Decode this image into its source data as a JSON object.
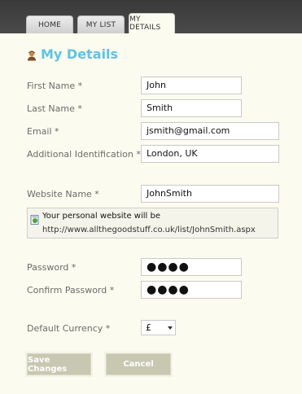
{
  "tabs": [
    {
      "label": "Home",
      "active": false
    },
    {
      "label": "My List",
      "active": false
    },
    {
      "label": "My Details",
      "active": true
    }
  ],
  "page": {
    "title": "My Details",
    "title_icon": "user-icon",
    "title_color": "#5ec3e6"
  },
  "form": {
    "first_name": {
      "label": "First Name *",
      "value": "John"
    },
    "last_name": {
      "label": "Last Name *",
      "value": "Smith"
    },
    "email": {
      "label": "Email *",
      "value": "jsmith@gmail.com"
    },
    "additional_id": {
      "label": "Additional Identification *",
      "value": "London, UK"
    },
    "website_name": {
      "label": "Website Name *",
      "value": "JohnSmith"
    },
    "website_info": {
      "line1": "Your personal website will be",
      "line2": "http://www.allthegoodstuff.co.uk/list/JohnSmith.aspx",
      "icon": "info-page-icon"
    },
    "password": {
      "label": "Password *",
      "value": "●●●●"
    },
    "confirm_password": {
      "label": "Confirm Password *",
      "value": "●●●●"
    },
    "currency": {
      "label": "Default Currency *",
      "value": "£"
    }
  },
  "buttons": {
    "save": "Save Changes",
    "cancel": "Cancel"
  }
}
